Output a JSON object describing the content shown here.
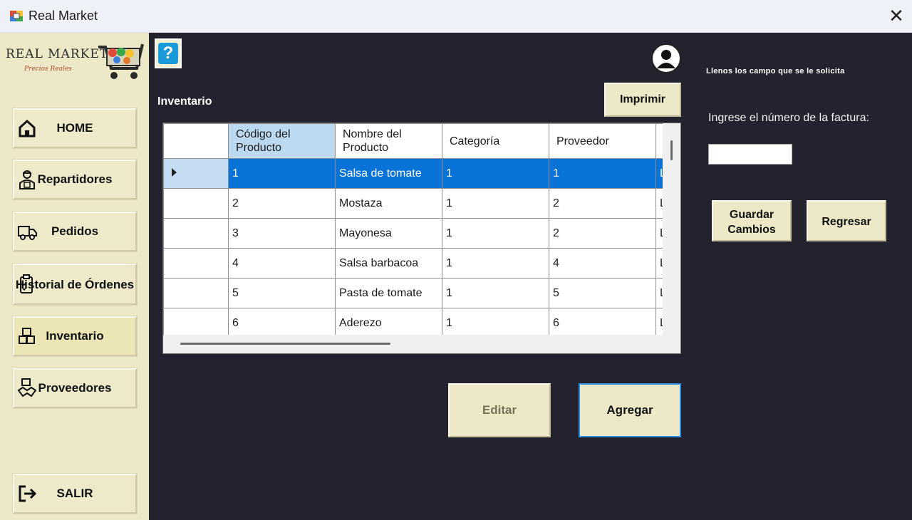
{
  "window": {
    "title": "Real Market",
    "close_label": "✕"
  },
  "logo": {
    "name": "REAL MARKET",
    "tagline": "Precios Reales"
  },
  "sidebar": {
    "items": [
      {
        "label": "HOME",
        "icon": "home-icon"
      },
      {
        "label": "Repartidores",
        "icon": "delivery-person-icon"
      },
      {
        "label": "Pedidos",
        "icon": "truck-icon"
      },
      {
        "label": "Historial de Órdenes",
        "icon": "clipboard-icon"
      },
      {
        "label": "Inventario",
        "icon": "inventory-boxes-icon",
        "active": true
      },
      {
        "label": "Proveedores",
        "icon": "handshake-icon"
      },
      {
        "label": "SALIR",
        "icon": "logout-icon"
      }
    ]
  },
  "main": {
    "help_label": "?",
    "section_title": "Inventario",
    "print_label": "Imprimir",
    "edit_label": "Editar",
    "add_label": "Agregar"
  },
  "grid": {
    "columns": [
      "Código del Producto",
      "Nombre del Producto",
      "Categoría",
      "Proveedor"
    ],
    "rows": [
      [
        "1",
        "Salsa de tomate",
        "1",
        "1"
      ],
      [
        "2",
        "Mostaza",
        "1",
        "2"
      ],
      [
        "3",
        "Mayonesa",
        "1",
        "2"
      ],
      [
        "4",
        "Salsa barbacoa",
        "1",
        "4"
      ],
      [
        "5",
        "Pasta de tomate",
        "1",
        "5"
      ],
      [
        "6",
        "Aderezo",
        "1",
        "6"
      ]
    ],
    "selected_row": 0
  },
  "right_panel": {
    "hint": "Llenos los campo que se le solicita",
    "invoice_label": "Ingrese el número de la factura:",
    "invoice_value": "",
    "save_label": "Guardar Cambios",
    "back_label": "Regresar"
  },
  "colors": {
    "sidebar_bg": "#ede8c8",
    "main_bg": "#24222f",
    "selection": "#0a73d8",
    "header_highlight": "#bcd9f0"
  }
}
